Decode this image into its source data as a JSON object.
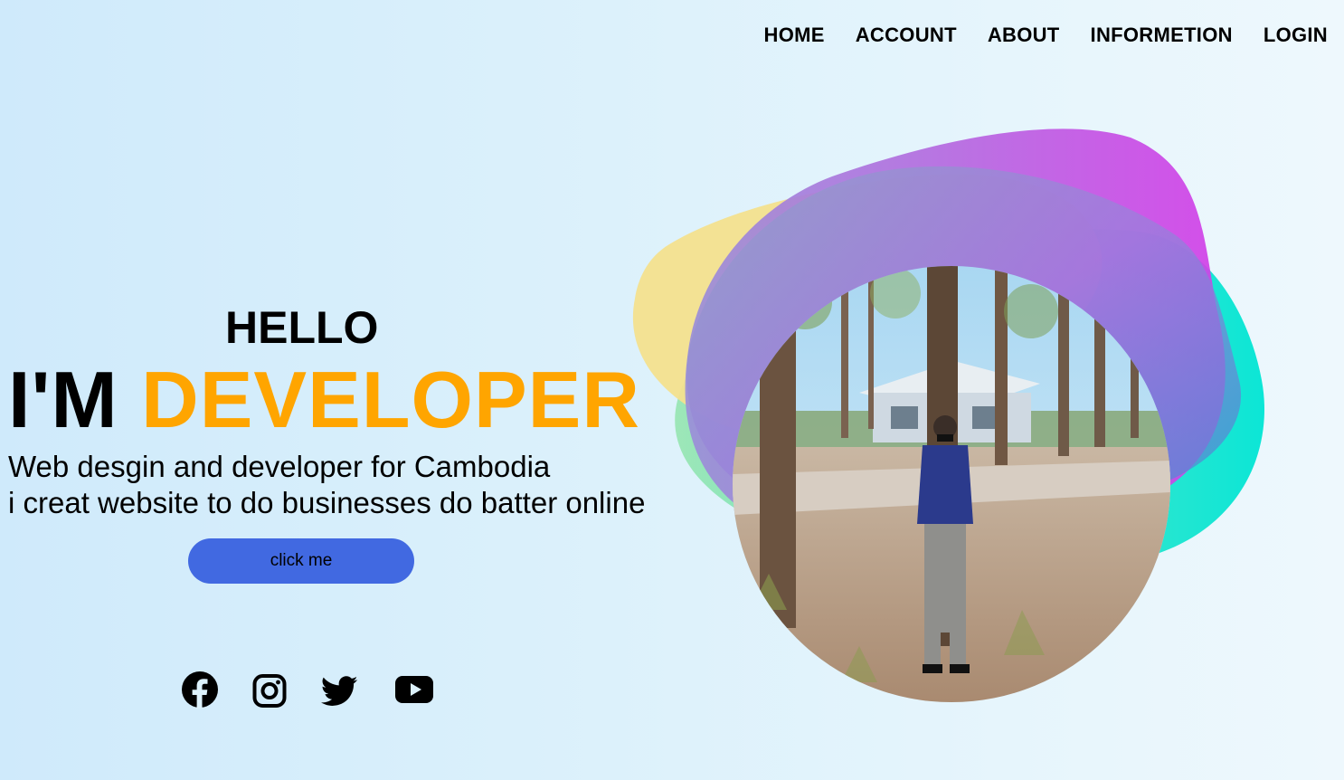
{
  "nav": {
    "items": [
      "HOME",
      "ACCOUNT",
      "ABOUT",
      "INFORMETION",
      "LOGIN"
    ]
  },
  "hero": {
    "greeting": "HELLO",
    "headline_prefix": "I'M",
    "headline_highlight": "DEVELOPER",
    "subline_1": "Web desgin and developer for Cambodia",
    "subline_2": "i creat website to do businesses do batter online",
    "button_label": "click me"
  },
  "social": {
    "icons": [
      "facebook-icon",
      "instagram-icon",
      "twitter-icon",
      "youtube-icon"
    ]
  },
  "colors": {
    "accent": "#ffa500",
    "button": "#4169e1",
    "text": "#000000"
  }
}
